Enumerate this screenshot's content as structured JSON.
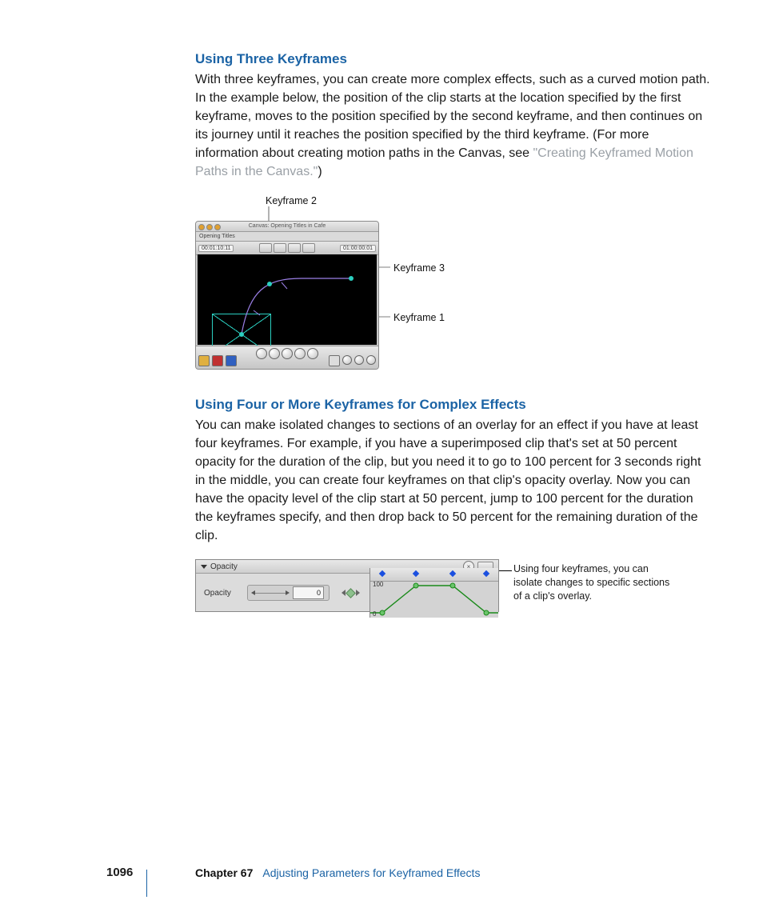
{
  "section1": {
    "heading": "Using Three Keyframes",
    "body_a": "With three keyframes, you can create more complex effects, such as a curved motion path. In the example below, the position of the clip starts at the location specified by the first keyframe, moves to the position specified by the second keyframe, and then continues on its journey until it reaches the position specified by the third keyframe. (For more information about creating motion paths in the Canvas, see ",
    "link": "\"Creating Keyframed Motion Paths in the Canvas.\"",
    "body_b": ")"
  },
  "figure1": {
    "title": "Canvas: Opening Titles in Cafe",
    "tab": "Opening Titles",
    "tc_left": "00:01:10:11",
    "tc_right": "01:00:00:01",
    "labels": {
      "k1": "Keyframe 1",
      "k2": "Keyframe 2",
      "k3": "Keyframe 3"
    }
  },
  "section2": {
    "heading": "Using Four or More Keyframes for Complex Effects",
    "body": "You can make isolated changes to sections of an overlay for an effect if you have at least four keyframes. For example, if you have a superimposed clip that's set at 50 percent opacity for the duration of the clip, but you need it to go to 100 percent for 3 seconds right in the middle, you can create four keyframes on that clip's opacity overlay. Now you can have the opacity level of the clip start at 50 percent, jump to 100 percent for the duration the keyframes specify, and then drop back to 50 percent for the remaining duration of the clip."
  },
  "figure2": {
    "panel_label": "Opacity",
    "row_label": "Opacity",
    "value": "0",
    "scale_top": "100",
    "scale_bottom": "0",
    "callout": "Using four keyframes, you can isolate changes to specific sections of a clip's overlay."
  },
  "footer": {
    "page": "1096",
    "chapter_no": "Chapter 67",
    "chapter_title": "Adjusting Parameters for Keyframed Effects"
  }
}
